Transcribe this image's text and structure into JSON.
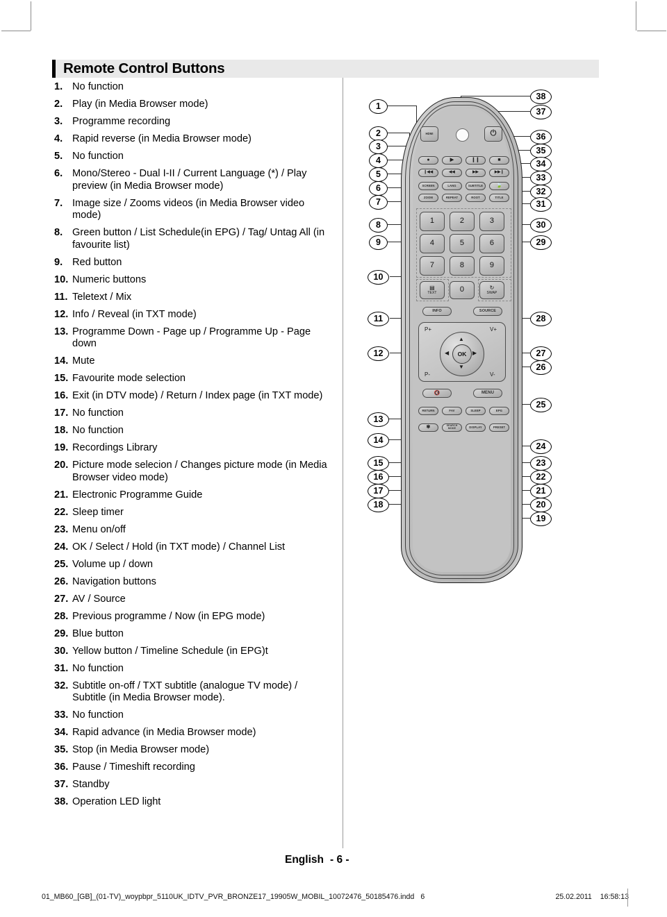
{
  "header": {
    "title": "Remote Control Buttons"
  },
  "items": [
    {
      "num": "1.",
      "text": "No function"
    },
    {
      "num": "2.",
      "text": "Play (in Media Browser mode)"
    },
    {
      "num": "3.",
      "text": "Programme recording"
    },
    {
      "num": "4.",
      "text": "Rapid reverse (in Media Browser mode)"
    },
    {
      "num": "5.",
      "text": "No function"
    },
    {
      "num": "6.",
      "text": "Mono/Stereo - Dual I-II / Current Language (*) / Play preview (in Media Browser mode)"
    },
    {
      "num": "7.",
      "text": "Image size / Zooms videos (in Media Browser video mode)"
    },
    {
      "num": "8.",
      "text": "Green button / List Schedule(in EPG) / Tag/ Untag All (in favourite list)"
    },
    {
      "num": "9.",
      "text": "Red button"
    },
    {
      "num": "10.",
      "text": "Numeric buttons"
    },
    {
      "num": "11.",
      "text": "Teletext / Mix"
    },
    {
      "num": "12.",
      "text": "Info / Reveal (in TXT mode)"
    },
    {
      "num": "13.",
      "text": "Programme Down - Page up / Programme Up - Page down"
    },
    {
      "num": "14.",
      "text": "Mute"
    },
    {
      "num": "15.",
      "text": "Favourite mode selection"
    },
    {
      "num": "16.",
      "text": "Exit (in DTV mode) / Return / Index page (in TXT mode)"
    },
    {
      "num": "17.",
      "text": "No function"
    },
    {
      "num": "18.",
      "text": "No function"
    },
    {
      "num": "19.",
      "text": "Recordings Library"
    },
    {
      "num": "20.",
      "text": "Picture mode selecion / Changes picture mode (in Media Browser video mode)"
    },
    {
      "num": "21.",
      "text": "Electronic Programme Guide"
    },
    {
      "num": "22.",
      "text": "Sleep timer"
    },
    {
      "num": "23.",
      "text": "Menu on/off"
    },
    {
      "num": "24.",
      "text": "OK / Select / Hold (in TXT mode) / Channel List"
    },
    {
      "num": "25.",
      "text": "Volume up / down"
    },
    {
      "num": "26.",
      "text": "Navigation buttons"
    },
    {
      "num": "27.",
      "text": "AV / Source"
    },
    {
      "num": "28.",
      "text": "Previous programme / Now (in EPG mode)"
    },
    {
      "num": "29.",
      "text": "Blue button"
    },
    {
      "num": "30.",
      "text": "Yellow button / Timeline Schedule (in EPG)t"
    },
    {
      "num": "31.",
      "text": "No function"
    },
    {
      "num": "32.",
      "text": "Subtitle on-off / TXT subtitle (analogue TV mode) / Subtitle (in Media Browser mode)."
    },
    {
      "num": "33.",
      "text": "No function"
    },
    {
      "num": "34.",
      "text": "Rapid advance (in Media Browser mode)"
    },
    {
      "num": "35.",
      "text": "Stop (in Media Browser mode)"
    },
    {
      "num": "36.",
      "text": "Pause / Timeshift recording"
    },
    {
      "num": "37.",
      "text": "Standby"
    },
    {
      "num": "38.",
      "text": "Operation LED light"
    }
  ],
  "page_label": {
    "language": "English",
    "number": "- 6 -"
  },
  "footer": {
    "filename": "01_MB60_[GB]_(01-TV)_woypbpr_5110UK_IDTV_PVR_BRONZE17_19905W_MOBIL_10072476_50185476.indd",
    "page": "6",
    "date": "25.02.2011",
    "time": "16:58:13"
  },
  "remote": {
    "callouts_left": [
      "1",
      "2",
      "3",
      "4",
      "5",
      "6",
      "7",
      "8",
      "9",
      "10",
      "11",
      "12",
      "13",
      "14",
      "15",
      "16",
      "17",
      "18"
    ],
    "callouts_right": [
      "38",
      "37",
      "36",
      "35",
      "34",
      "33",
      "32",
      "31",
      "30",
      "29",
      "28",
      "27",
      "26",
      "25",
      "24",
      "23",
      "22",
      "21",
      "20",
      "19"
    ],
    "keys": {
      "hdmi": "HDMI",
      "power": "⏻",
      "record": "●",
      "play": "▶",
      "pause": "❙❙",
      "stop": "■",
      "prev": "❙◀◀",
      "rewind": "◀◀",
      "forward": "▶▶",
      "next": "▶▶❙",
      "screen": "SCREEN",
      "lang": "LANG",
      "subtitle": "SUBTITLE",
      "leaf": "🍃",
      "zoom": "ZOOM",
      "repeat": "REPEAT",
      "root": "ROOT",
      "title": "TITLE",
      "num1": "1",
      "num2": "2",
      "num3": "3",
      "num4": "4",
      "num5": "5",
      "num6": "6",
      "num7": "7",
      "num8": "8",
      "num9": "9",
      "num0": "0",
      "text": "TEXT",
      "swap": "SWAP",
      "info": "INFO",
      "source": "SOURCE",
      "p_up": "P+",
      "p_down": "P-",
      "v_up": "V+",
      "v_down": "V-",
      "ok": "OK",
      "arrow_up": "▲",
      "arrow_down": "▼",
      "arrow_left": "◀",
      "arrow_right": "▶",
      "mute": "🔇",
      "menu": "MENU",
      "return": "RETURN",
      "fav": "FAV",
      "sleep": "SLEEP",
      "epg": "EPG",
      "picture_mode": "✾",
      "search_mode": "SEARCH MODE",
      "display": "DISPLAY",
      "preset": "PRESET"
    }
  }
}
